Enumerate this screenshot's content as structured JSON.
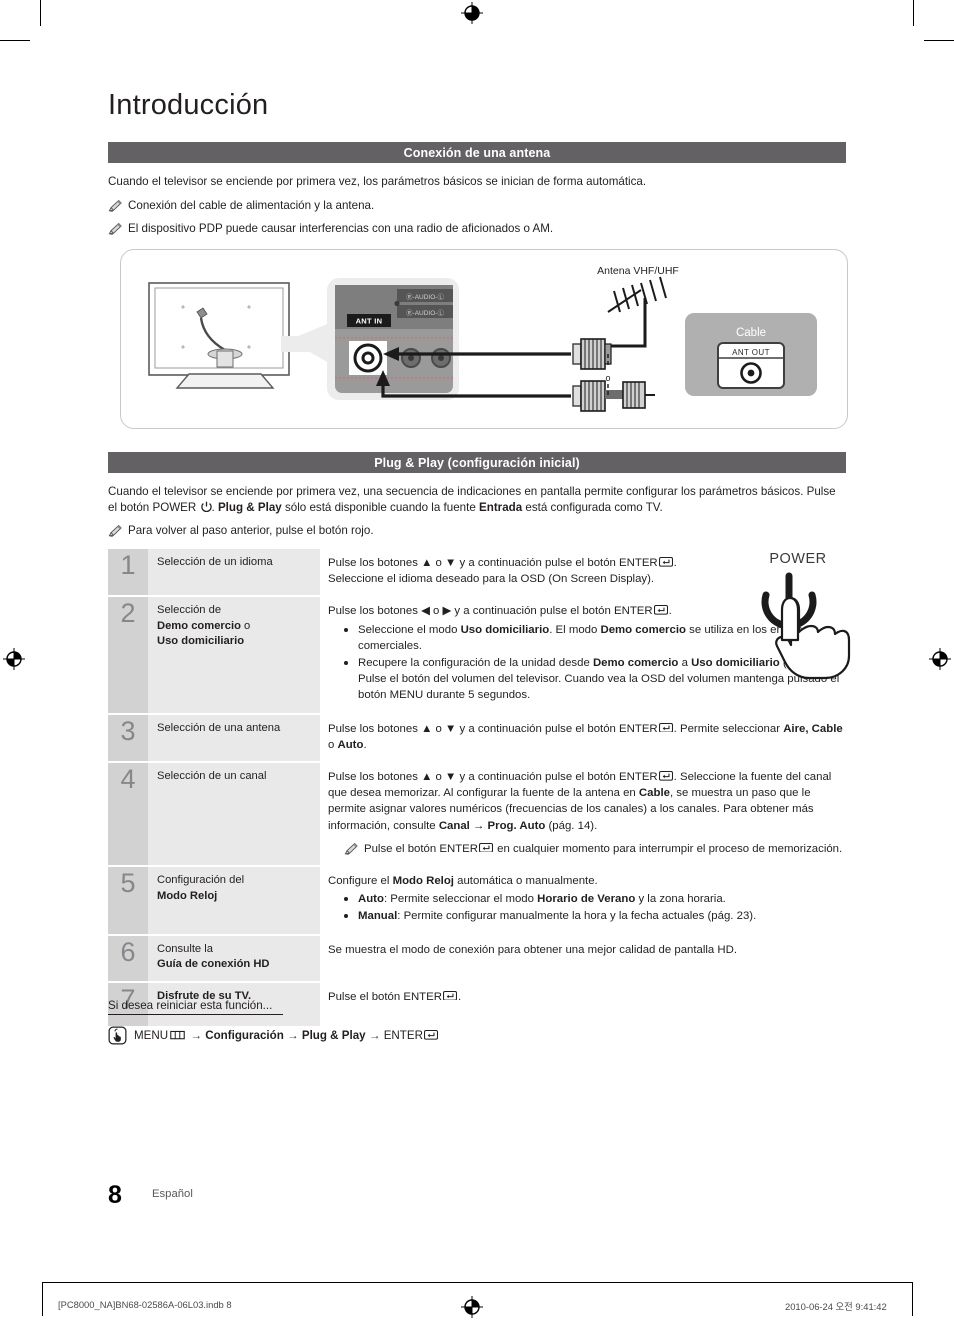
{
  "page": {
    "title": "Introducción",
    "number": "8",
    "language_label": "Español"
  },
  "sections": {
    "antenna": {
      "bar_title": "Conexión de una antena",
      "intro": "Cuando el televisor se enciende por primera vez, los parámetros básicos se inician de forma automática.",
      "note1": "Conexión del cable de alimentación y la antena.",
      "note2": "El dispositivo PDP puede causar interferencias con una radio de aficionados o AM.",
      "diagram": {
        "antenna_label": "Antena VHF/UHF",
        "ant_in_label": "ANT IN",
        "cable_label": "Cable",
        "ant_out_label": "ANT OUT",
        "audio_label_1": "AUDIO",
        "audio_label_2": "AUDIO",
        "audio_r": "R",
        "audio_l": "L"
      }
    },
    "plugplay": {
      "bar_title": "Plug & Play (configuración inicial)",
      "intro_a": "Cuando el televisor se enciende por primera vez, una secuencia de indicaciones en pantalla permite configurar los parámetros básicos. Pulse el botón POWER ",
      "intro_b": ". ",
      "intro_bold1": "Plug & Play",
      "intro_c": " sólo está disponible cuando la fuente ",
      "intro_bold2": "Entrada",
      "intro_d": " está configurada como TV.",
      "note1": "Para volver al paso anterior, pulse el botón rojo.",
      "power_illustration_label": "POWER"
    },
    "reset": {
      "heading": "Si desea reiniciar esta función...",
      "path_menu": "MENU",
      "path_arrow1": "→",
      "path_config": "Configuración",
      "path_arrow2": "→",
      "path_plugplay": "Plug & Play",
      "path_arrow3": "→",
      "path_enter": "ENTER"
    }
  },
  "steps": [
    {
      "num": "1",
      "label_plain": "Selección de un idioma",
      "label_bold": "",
      "label_bold2": "",
      "desc_line1_a": "Pulse los botones ▲ o ▼ y a continuación pulse el botón ENTER",
      "desc_line1_b": ".",
      "desc_line2": "Seleccione el idioma deseado para la OSD (On Screen Display).",
      "bullets": []
    },
    {
      "num": "2",
      "label_plain": "Selección de",
      "label_bold": "Demo comercio",
      "label_mid": " o",
      "label_bold2": "Uso domiciliario",
      "desc_line1_a": "Pulse los botones ◀ o ▶ y a continuación pulse el botón ENTER",
      "desc_line1_b": ".",
      "bullets": [
        "Seleccione el modo <b>Uso domiciliario</b>. El modo <b>Demo comercio</b> se utiliza en los entornos comerciales.",
        "Recupere la configuración de la unidad desde <b>Demo comercio</b> a <b>Uso domiciliario</b> (estándar): Pulse el botón del volumen del televisor. Cuando vea la OSD del volumen mantenga pulsado el botón MENU durante 5 segundos."
      ]
    },
    {
      "num": "3",
      "label_plain": "Selección de una antena",
      "label_bold": "",
      "label_bold2": "",
      "desc_line1_a": "Pulse los botones ▲ o ▼ y a continuación pulse el botón ENTER",
      "desc_line1_b": ". Permite seleccionar <b>Aire, Cable</b> o <b>Auto</b>.",
      "bullets": []
    },
    {
      "num": "4",
      "label_plain": "Selección de un canal",
      "label_bold": "",
      "label_bold2": "",
      "desc_line1_a": "Pulse los botones ▲ o ▼ y a continuación pulse el botón ENTER",
      "desc_line1_b": ". Seleccione la fuente del canal que desea memorizar. Al configurar la fuente de la antena en <b>Cable</b>, se muestra un paso que le permite asignar valores numéricos (frecuencias de los canales) a los canales. Para obtener más información, consulte <b>Canal → Prog. Auto</b> (pág. 14).",
      "subnote_a": "Pulse el botón ENTER",
      "subnote_b": " en cualquier momento para interrumpir el proceso de memorización.",
      "bullets": []
    },
    {
      "num": "5",
      "label_plain": "Configuración del",
      "label_bold": "Modo Reloj",
      "label_bold2": "",
      "desc_line1_a": "Configure el <b>Modo Reloj</b> automática o manualmente.",
      "desc_line1_b": "",
      "bullets": [
        "<b>Auto</b>: Permite seleccionar el modo <b>Horario de Verano</b> y la zona horaria.",
        "<b>Manual</b>: Permite configurar manualmente la hora y la fecha actuales (pág. 23)."
      ]
    },
    {
      "num": "6",
      "label_plain": "Consulte la",
      "label_bold": "Guía de conexión HD",
      "label_bold2": "",
      "desc_line1_a": "Se muestra el modo de conexión para obtener una mejor calidad de pantalla HD.",
      "desc_line1_b": "",
      "bullets": []
    },
    {
      "num": "7",
      "label_plain": "",
      "label_bold": "Disfrute de su TV.",
      "label_bold2": "",
      "desc_line1_a": "Pulse el botón ENTER",
      "desc_line1_b": ".",
      "bullets": []
    }
  ],
  "print_footer": {
    "file": "[PC8000_NA]BN68-02586A-06L03.indb   8",
    "timestamp": "2010-06-24   오전 9:41:42"
  },
  "colors": {
    "section_bar": "#646164",
    "step_number_cell": "#d2d2d2",
    "step_label_cell": "#e9e9e9",
    "text": "#231f20"
  }
}
